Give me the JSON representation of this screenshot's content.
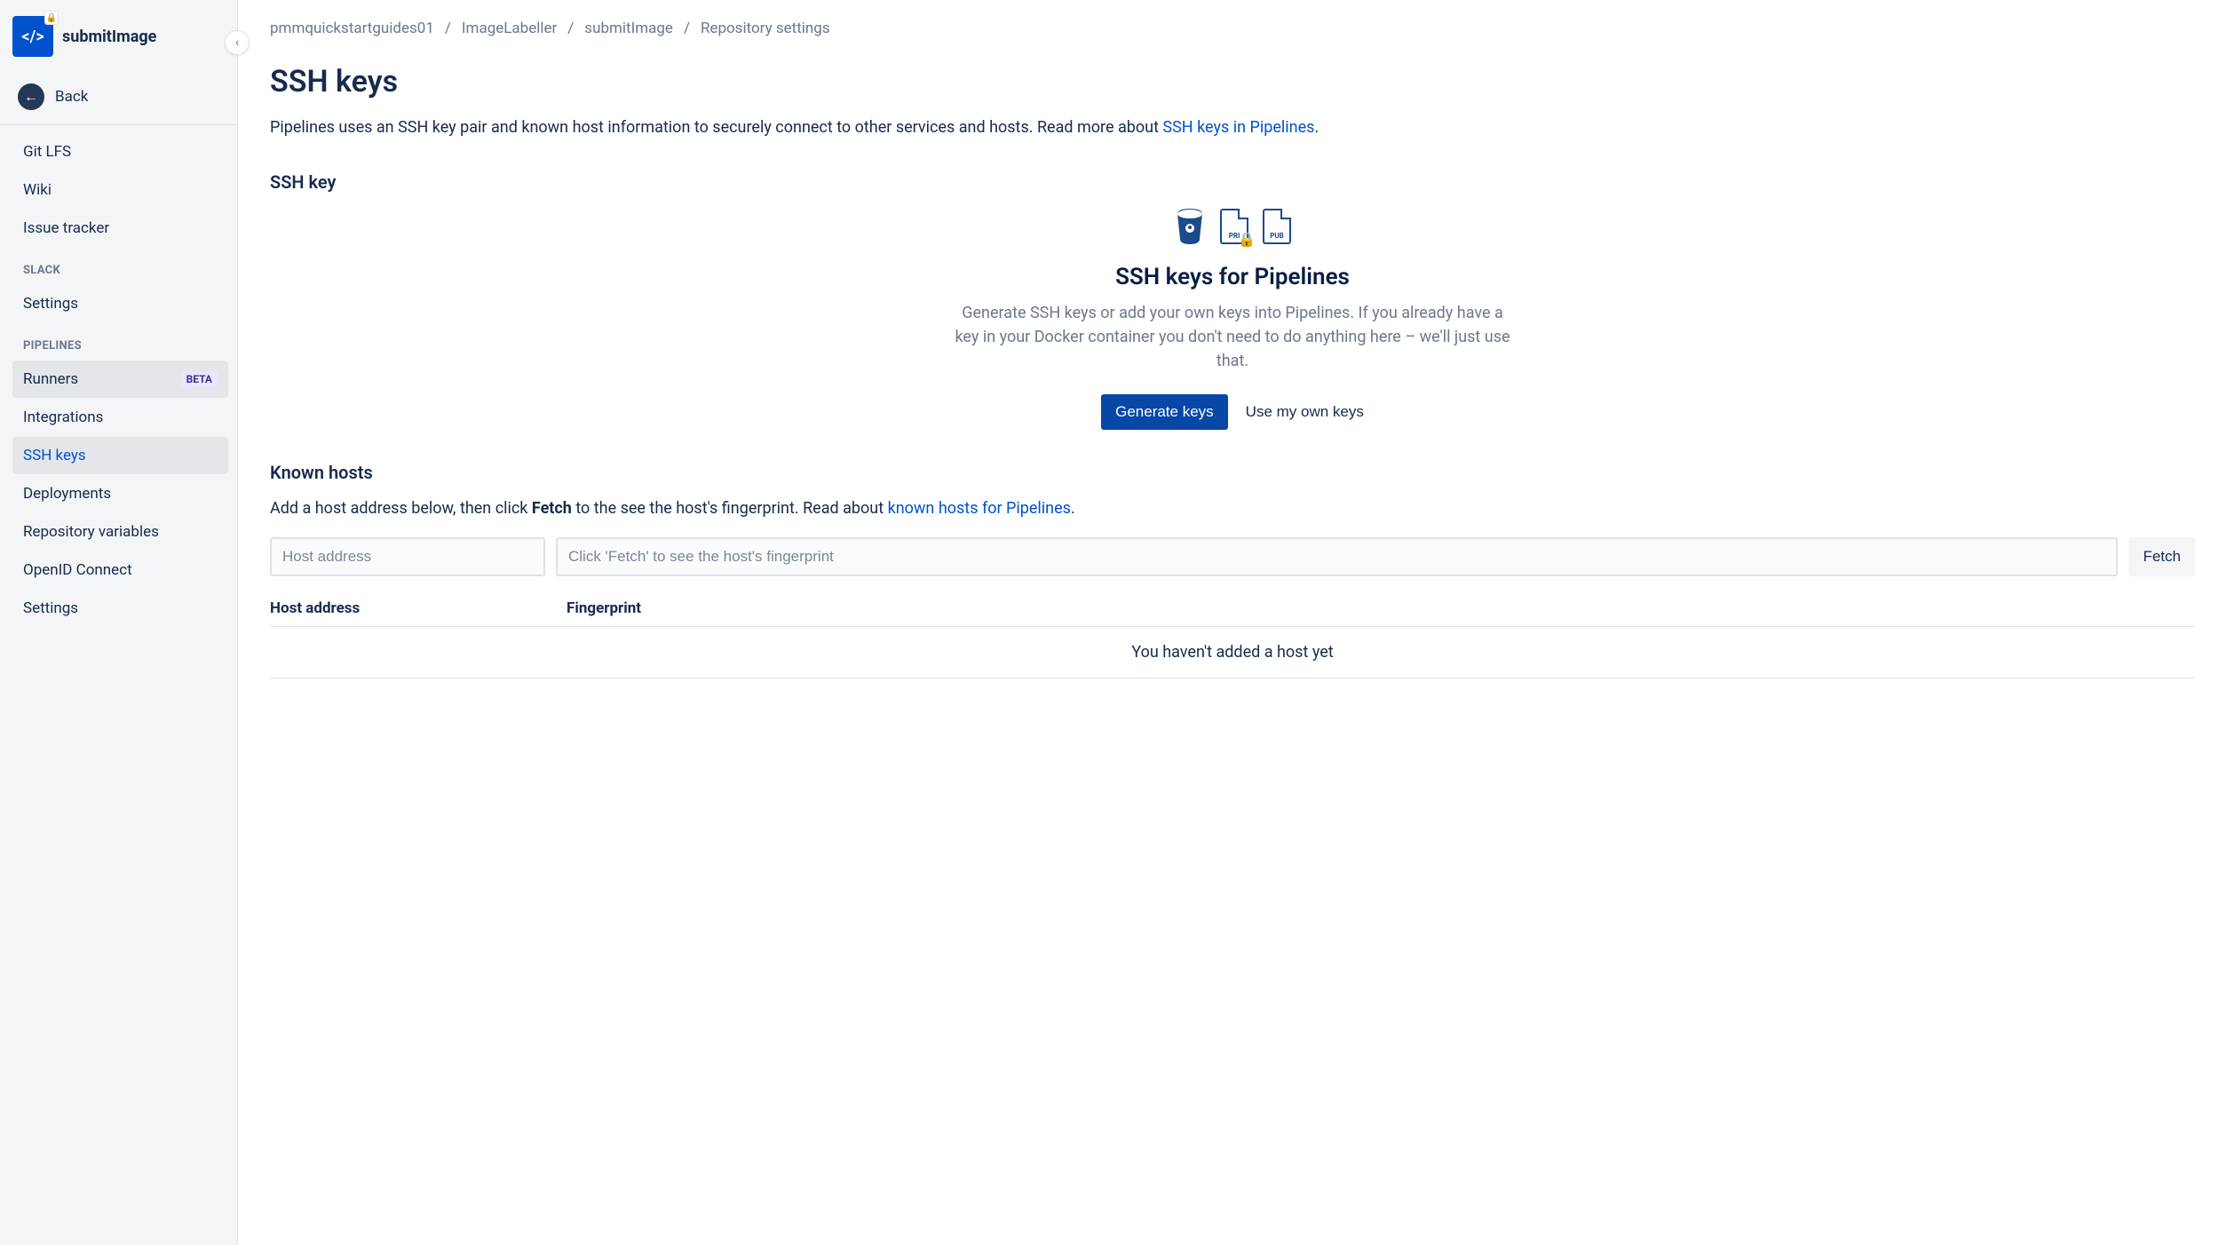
{
  "sidebar": {
    "repo_name": "submitImage",
    "back_label": "Back",
    "nav_top": [
      {
        "label": "Git LFS"
      },
      {
        "label": "Wiki"
      },
      {
        "label": "Issue tracker"
      }
    ],
    "slack_label": "SLACK",
    "slack_items": [
      {
        "label": "Settings"
      }
    ],
    "pipelines_label": "PIPELINES",
    "pipelines_items": [
      {
        "label": "Runners",
        "badge": "BETA"
      },
      {
        "label": "Integrations"
      },
      {
        "label": "SSH keys",
        "active": true
      },
      {
        "label": "Deployments"
      },
      {
        "label": "Repository variables"
      },
      {
        "label": "OpenID Connect"
      },
      {
        "label": "Settings"
      }
    ]
  },
  "breadcrumbs": [
    "pmmquickstartguides01",
    "ImageLabeller",
    "submitImage",
    "Repository settings"
  ],
  "page": {
    "title": "SSH keys",
    "intro_prefix": "Pipelines uses an SSH key pair and known host information to securely connect to other services and hosts. Read more about ",
    "intro_link": "SSH keys in Pipelines",
    "ssh_key_heading": "SSH key",
    "card_title": "SSH keys for Pipelines",
    "card_desc": "Generate SSH keys or add your own keys into Pipelines. If you already have a key in your Docker container you don't need to do anything here – we'll just use that.",
    "generate_btn": "Generate keys",
    "use_own_btn": "Use my own keys",
    "known_hosts_heading": "Known hosts",
    "kh_desc_prefix": "Add a host address below, then click ",
    "kh_desc_bold": "Fetch",
    "kh_desc_suffix": " to the see the host's fingerprint. Read about ",
    "kh_desc_link": "known hosts for Pipelines",
    "host_placeholder": "Host address",
    "fingerprint_placeholder": "Click 'Fetch' to see the host's fingerprint",
    "fetch_btn": "Fetch",
    "kh_col1": "Host address",
    "kh_col2": "Fingerprint",
    "kh_empty": "You haven't added a host yet"
  }
}
